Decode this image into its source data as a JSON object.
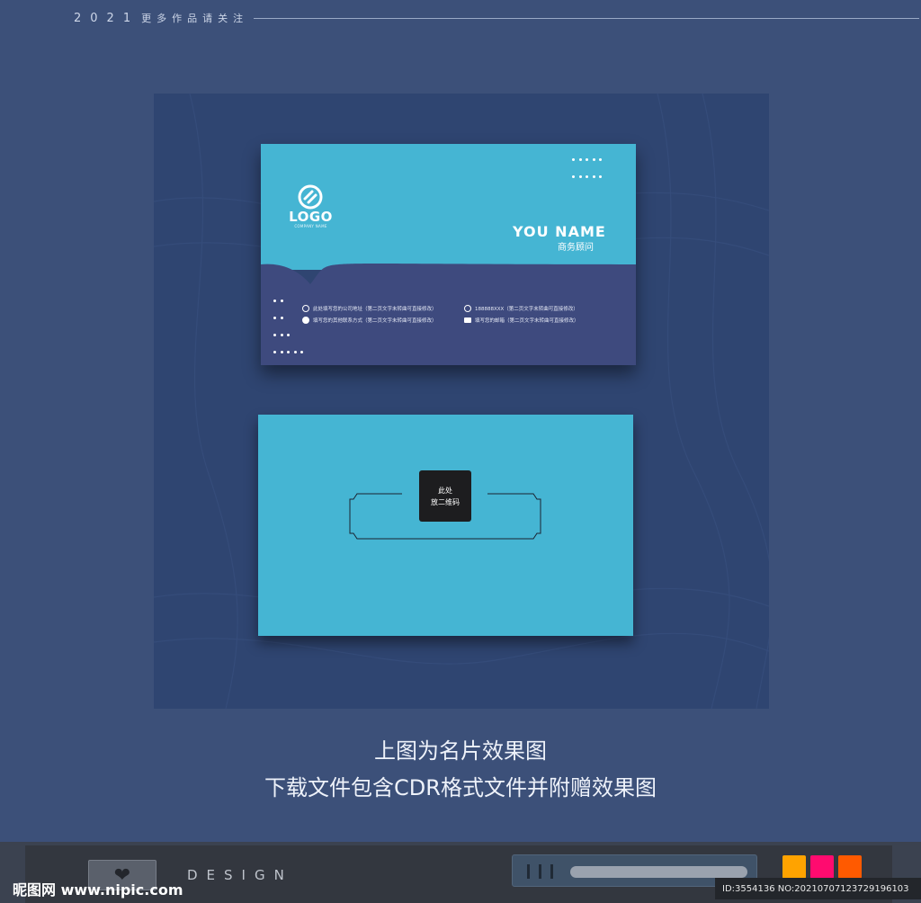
{
  "header": {
    "year": "2021",
    "note": "更多作品请关注"
  },
  "card_front": {
    "logo": "LOGO",
    "logo_sub": "COMPANY NAME",
    "name": "YOU NAME",
    "title": "商务顾问",
    "info": [
      {
        "icon": "location-icon",
        "text": "此处填写您的公司地址（第二页文字未转曲可直接修改）"
      },
      {
        "icon": "phone-icon",
        "text": "188888XXX（第二页文字未转曲可直接修改）"
      },
      {
        "icon": "contact-icon",
        "text": "填写您的其他联系方式（第二页文字未转曲可直接修改）"
      },
      {
        "icon": "mail-icon",
        "text": "填写您的邮箱（第二页文字未转曲可直接修改）"
      }
    ]
  },
  "card_back": {
    "qr_line1": "此处",
    "qr_line2": "放二维码"
  },
  "captions": {
    "line1": "上图为名片效果图",
    "line2": "下载文件包含CDR格式文件并附赠效果图"
  },
  "footer": {
    "design": "DESIGN",
    "brand": "昵图网 www.nipic.com",
    "id_text": "ID:3554136 NO:20210707123729196103",
    "heart_icon": "heart-icon",
    "swatches": [
      "#ffa300",
      "#ff0b6f",
      "#ff5a00"
    ]
  },
  "colors": {
    "page_bg": "#3c5079",
    "card_cyan": "#45b5d3",
    "card_navy": "#3e4a7e"
  }
}
